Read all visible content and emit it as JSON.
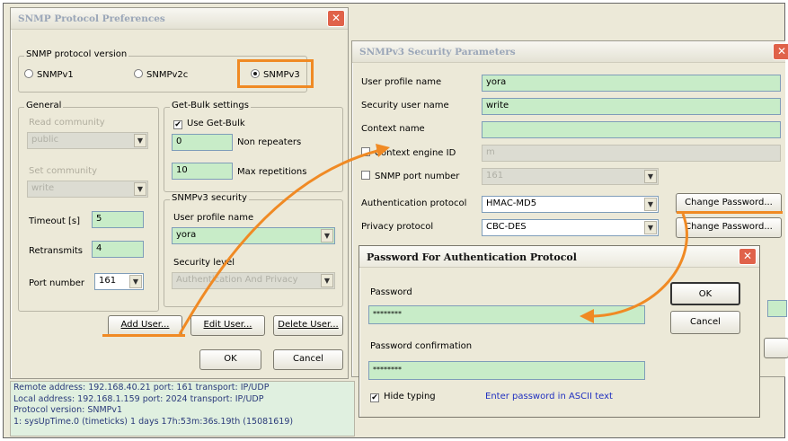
{
  "prefs": {
    "title": "SNMP Protocol Preferences",
    "close": "✕",
    "version_group": "SNMP protocol version",
    "versions": [
      "SNMPv1",
      "SNMPv2c",
      "SNMPv3"
    ],
    "general_group": "General",
    "read_community_label": "Read community",
    "read_community_value": "public",
    "set_community_label": "Set community",
    "set_community_value": "write",
    "timeout_label": "Timeout [s]",
    "timeout_value": "5",
    "retransmits_label": "Retransmits",
    "retransmits_value": "4",
    "port_label": "Port number",
    "port_value": "161",
    "getbulk_group": "Get-Bulk settings",
    "use_getbulk": "Use Get-Bulk",
    "non_repeaters_value": "0",
    "non_repeaters_label": "Non repeaters",
    "max_rep_value": "10",
    "max_rep_label": "Max repetitions",
    "v3sec_group": "SNMPv3 security",
    "user_profile_label": "User profile name",
    "user_profile_value": "yora",
    "security_level_label": "Security level",
    "security_level_value": "Authentication And Privacy",
    "add_user": "Add User...",
    "edit_user": "Edit User...",
    "delete_user": "Delete User...",
    "ok": "OK",
    "cancel": "Cancel"
  },
  "v3params": {
    "title": "SNMPv3 Security Parameters",
    "close": "✕",
    "user_profile_label": "User profile name",
    "user_profile_value": "yora",
    "security_user_label": "Security user name",
    "security_user_value": "write",
    "context_name_label": "Context name",
    "context_name_value": "",
    "context_engine_label": "Context engine ID",
    "context_engine_value": "m",
    "snmp_port_label": "SNMP port number",
    "snmp_port_value": "161",
    "auth_protocol_label": "Authentication protocol",
    "auth_protocol_value": "HMAC-MD5",
    "privacy_protocol_label": "Privacy protocol",
    "privacy_protocol_value": "CBC-DES",
    "change_password": "Change Password..."
  },
  "pwdialog": {
    "title": "Password For Authentication Protocol",
    "close": "✕",
    "password_label": "Password",
    "password_value": "********",
    "confirm_label": "Password confirmation",
    "confirm_value": "********",
    "hide_typing": "Hide typing",
    "ascii_hint": "Enter password in ASCII text",
    "ok": "OK",
    "cancel": "Cancel"
  },
  "log": [
    "Remote address: 192.168.40.21  port: 161 transport: IP/UDP",
    "Local address: 192.168.1.159  port: 2024 transport: IP/UDP",
    "Protocol version: SNMPv1",
    "1: sysUpTime.0 (timeticks) 1 days 17h:53m:36s.19th (15081619)"
  ],
  "log_protocol_value": "SNMPv1",
  "colors": {
    "accent": "#f08a24",
    "field": "#c8ecc8",
    "window": "#ece9d8",
    "link": "#2030c0"
  }
}
